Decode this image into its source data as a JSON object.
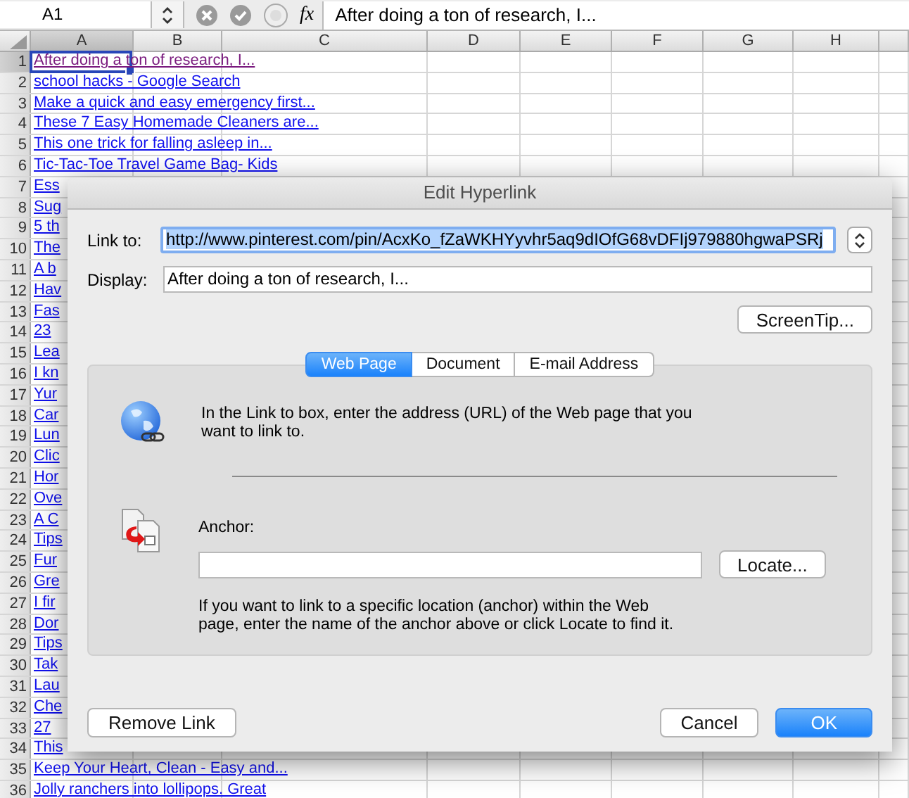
{
  "formula_bar": {
    "name_box": "A1",
    "function_label": "fx",
    "formula": "After doing a ton of research, I..."
  },
  "columns": [
    {
      "label": "A",
      "selected": true
    },
    {
      "label": "B",
      "selected": false
    },
    {
      "label": "C",
      "selected": false
    },
    {
      "label": "D",
      "selected": false
    },
    {
      "label": "E",
      "selected": false
    },
    {
      "label": "F",
      "selected": false
    },
    {
      "label": "G",
      "selected": false
    },
    {
      "label": "H",
      "selected": false
    }
  ],
  "rows": [
    {
      "number": "1",
      "text": "After doing a ton of research, I...",
      "visited": true,
      "selected": true
    },
    {
      "number": "2",
      "text": "school hacks - Google Search",
      "visited": false,
      "selected": false
    },
    {
      "number": "3",
      "text": "Make a quick and easy emergency first...",
      "visited": false,
      "selected": false
    },
    {
      "number": "4",
      "text": "These 7 Easy Homemade Cleaners are...",
      "visited": false,
      "selected": false
    },
    {
      "number": "5",
      "text": "This one trick for falling asleep in...",
      "visited": false,
      "selected": false
    },
    {
      "number": "6",
      "text": "Tic-Tac-Toe Travel Game Bag- Kids",
      "visited": false,
      "selected": false
    },
    {
      "number": "7",
      "text": "Ess",
      "visited": false,
      "selected": false
    },
    {
      "number": "8",
      "text": "Sug",
      "visited": false,
      "selected": false
    },
    {
      "number": "9",
      "text": "5 th",
      "visited": false,
      "selected": false
    },
    {
      "number": "10",
      "text": "The",
      "visited": false,
      "selected": false
    },
    {
      "number": "11",
      "text": "A b",
      "visited": false,
      "selected": false
    },
    {
      "number": "12",
      "text": "Hav",
      "visited": false,
      "selected": false
    },
    {
      "number": "13",
      "text": "Fas",
      "visited": false,
      "selected": false
    },
    {
      "number": "14",
      "text": "23",
      "visited": false,
      "selected": false
    },
    {
      "number": "15",
      "text": "Lea",
      "visited": false,
      "selected": false
    },
    {
      "number": "16",
      "text": "I kn",
      "visited": false,
      "selected": false
    },
    {
      "number": "17",
      "text": "Yur",
      "visited": false,
      "selected": false
    },
    {
      "number": "18",
      "text": "Car",
      "visited": false,
      "selected": false
    },
    {
      "number": "19",
      "text": "Lun",
      "visited": false,
      "selected": false
    },
    {
      "number": "20",
      "text": "Clic",
      "visited": false,
      "selected": false
    },
    {
      "number": "21",
      "text": "Hor",
      "visited": false,
      "selected": false
    },
    {
      "number": "22",
      "text": "Ove",
      "visited": false,
      "selected": false
    },
    {
      "number": "23",
      "text": "A C",
      "visited": false,
      "selected": false
    },
    {
      "number": "24",
      "text": "Tips",
      "visited": false,
      "selected": false
    },
    {
      "number": "25",
      "text": "Fur",
      "visited": false,
      "selected": false
    },
    {
      "number": "26",
      "text": "Gre",
      "visited": false,
      "selected": false
    },
    {
      "number": "27",
      "text": "I fir",
      "visited": false,
      "selected": false
    },
    {
      "number": "28",
      "text": "Dor",
      "visited": false,
      "selected": false
    },
    {
      "number": "29",
      "text": "Tips",
      "visited": false,
      "selected": false
    },
    {
      "number": "30",
      "text": "Tak",
      "visited": false,
      "selected": false
    },
    {
      "number": "31",
      "text": "Lau",
      "visited": false,
      "selected": false
    },
    {
      "number": "32",
      "text": "Che",
      "visited": false,
      "selected": false
    },
    {
      "number": "33",
      "text": "27",
      "visited": false,
      "selected": false
    },
    {
      "number": "34",
      "text": "This",
      "visited": false,
      "selected": false
    },
    {
      "number": "35",
      "text": "Keep Your Heart, Clean - Easy and...",
      "visited": false,
      "selected": false
    },
    {
      "number": "36",
      "text": "Jolly ranchers into lollipops. Great",
      "visited": false,
      "selected": false
    }
  ],
  "dialog": {
    "title": "Edit Hyperlink",
    "link_to": {
      "label": "Link to:",
      "value": "http://www.pinterest.com/pin/AcxKo_fZaWKHYyvhr5aq9dIOfG68vDFIj979880hgwaPSRj",
      "selected": true
    },
    "display": {
      "label": "Display:",
      "value": "After doing a ton of research, I..."
    },
    "screentip_button": "ScreenTip...",
    "tabs": [
      {
        "label": "Web Page",
        "selected": true
      },
      {
        "label": "Document",
        "selected": false
      },
      {
        "label": "E-mail Address",
        "selected": false
      }
    ],
    "web_page_help": "In the Link to box, enter the address (URL) of the Web page that you want to link to.",
    "anchor": {
      "label": "Anchor:"
    },
    "locate_button": "Locate...",
    "anchor_help": "If you want to link to a specific location (anchor) within the Web page, enter the name of the anchor above or click Locate to find it.",
    "buttons": [
      {
        "label": "Remove Link",
        "kind": "secondary"
      },
      {
        "label": "Cancel",
        "kind": "plain"
      },
      {
        "label": "OK",
        "kind": "default"
      }
    ]
  }
}
